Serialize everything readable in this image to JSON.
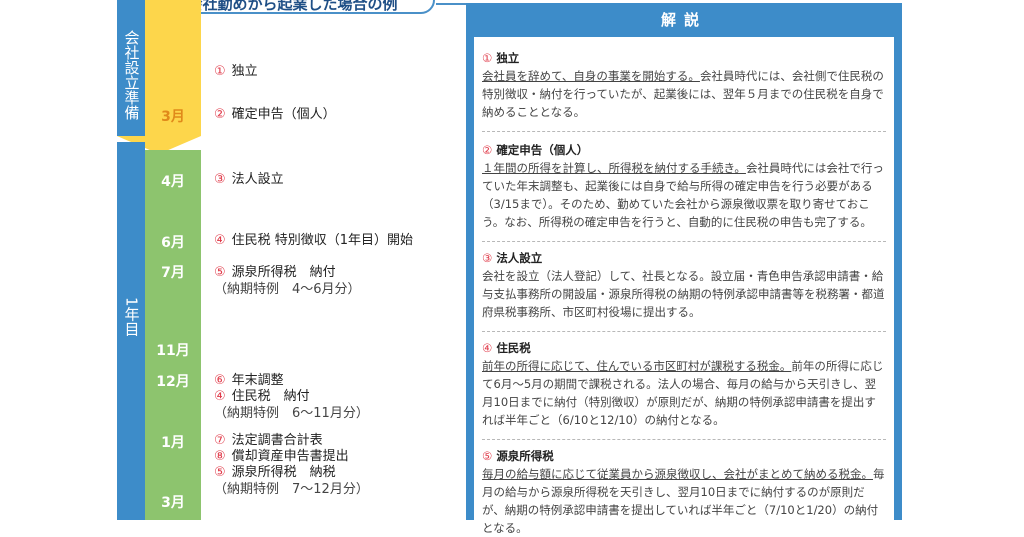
{
  "title": "会社勤めから起業した場合の例",
  "phases": {
    "prep": "会社設立準備",
    "year1": "1年目"
  },
  "months": {
    "m3a": "3月",
    "m4": "4月",
    "m6": "6月",
    "m7": "7月",
    "m11": "11月",
    "m12": "12月",
    "m1": "1月",
    "m3b": "3月"
  },
  "events": {
    "e1": {
      "num": "①",
      "label": "独立"
    },
    "e2": {
      "num": "②",
      "label": "確定申告（個人）"
    },
    "e3": {
      "num": "③",
      "label": "法人設立"
    },
    "e4": {
      "num": "④",
      "label": "住民税 特別徴収（1年目）開始"
    },
    "e5": {
      "num": "⑤",
      "label": "源泉所得税　納付",
      "sub": "（納期特例　4～6月分）"
    },
    "e6": {
      "num": "⑥",
      "label": "年末調整"
    },
    "e7": {
      "num": "④",
      "label": "住民税　納付",
      "sub": "（納期特例　6～11月分）"
    },
    "e8": {
      "num": "⑦",
      "label": "法定調書合計表"
    },
    "e9": {
      "num": "⑧",
      "label": "償却資産申告書提出"
    },
    "e10": {
      "num": "⑤",
      "label": "源泉所得税　納税",
      "sub": "（納期特例　7～12月分）"
    }
  },
  "panel": {
    "header": "解説",
    "sections": [
      {
        "num": "①",
        "title": "独立",
        "underline": "会社員を辞めて、自身の事業を開始する。",
        "rest": "会社員時代には、会社側で住民税の特別徴収・納付を行っていたが、起業後には、翌年５月までの住民税を自身で納めることとなる。"
      },
      {
        "num": "②",
        "title": "確定申告（個人）",
        "underline": "１年間の所得を計算し、所得税を納付する手続き。",
        "rest": "会社員時代には会社で行っていた年末調整も、起業後には自身で給与所得の確定申告を行う必要がある（3/15まで）。そのため、勤めていた会社から源泉徴収票を取り寄せておこう。なお、所得税の確定申告を行うと、自動的に住民税の申告も完了する。"
      },
      {
        "num": "③",
        "title": "法人設立",
        "underline": "",
        "rest": "会社を設立（法人登記）して、社長となる。設立届・青色申告承認申請書・給与支払事務所の開設届・源泉所得税の納期の特例承認申請書等を税務署・都道府県税事務所、市区町村役場に提出する。"
      },
      {
        "num": "④",
        "title": "住民税",
        "underline": "前年の所得に応じて、住んでいる市区町村が課税する税金。",
        "rest": "前年の所得に応じて6月～5月の期間で課税される。法人の場合、毎月の給与から天引きし、翌月10日までに納付（特別徴収）が原則だが、納期の特例承認申請書を提出すれば半年ごと（6/10と12/10）の納付となる。"
      },
      {
        "num": "⑤",
        "title": "源泉所得税",
        "underline": "毎月の給与額に応じて従業員から源泉徴収し、会社がまとめて納める税金。",
        "rest": "毎月の給与から源泉所得税を天引きし、翌月10日までに納付するのが原則だが、納期の特例承認申請書を提出していれば半年ごと（7/10と1/20）の納付となる。"
      }
    ]
  },
  "colors": {
    "blue": "#3d8cc9",
    "yellow": "#fdd64b",
    "green": "#8dc46e",
    "red_number": "#e03b4a"
  }
}
